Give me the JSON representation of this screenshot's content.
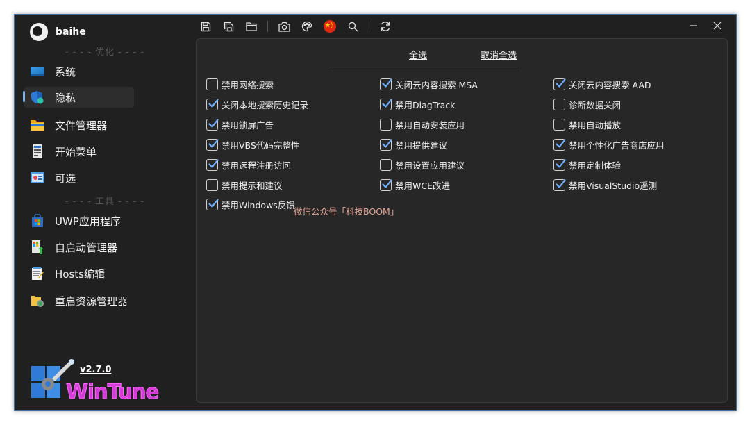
{
  "user": {
    "name": "baihe"
  },
  "sidebar": {
    "section_optimize": "- - - - 优化 - - - -",
    "section_tools": "- - - - 工具 - - - -",
    "items": [
      {
        "label": "系统",
        "icon": "monitor-icon"
      },
      {
        "label": "隐私",
        "icon": "shield-icon",
        "active": true
      },
      {
        "label": "文件管理器",
        "icon": "folder-icon"
      },
      {
        "label": "开始菜单",
        "icon": "start-menu-icon"
      },
      {
        "label": "可选",
        "icon": "options-icon"
      },
      {
        "label": "UWP应用程序",
        "icon": "windows-store-icon"
      },
      {
        "label": "自启动管理器",
        "icon": "startup-icon"
      },
      {
        "label": "Hosts编辑",
        "icon": "notepad-icon"
      },
      {
        "label": "重启资源管理器",
        "icon": "restart-explorer-icon"
      }
    ],
    "version": "v2.7.0",
    "logo_text": "WinTune"
  },
  "toolbar": {
    "buttons": [
      "save-icon",
      "save-all-icon",
      "open-folder-icon",
      "camera-icon",
      "palette-icon",
      "china-flag-icon",
      "search-icon",
      "refresh-icon"
    ]
  },
  "panel": {
    "select_all": "全选",
    "deselect_all": "取消全选",
    "options": [
      {
        "label": "禁用网络搜索",
        "checked": false
      },
      {
        "label": "关闭云内容搜索 MSA",
        "checked": true
      },
      {
        "label": "关闭云内容搜索 AAD",
        "checked": true
      },
      {
        "label": "关闭本地搜索历史记录",
        "checked": true
      },
      {
        "label": "禁用DiagTrack",
        "checked": true
      },
      {
        "label": "诊断数据关闭",
        "checked": false
      },
      {
        "label": "禁用锁屏广告",
        "checked": true
      },
      {
        "label": "禁用自动安装应用",
        "checked": false
      },
      {
        "label": "禁用自动播放",
        "checked": false
      },
      {
        "label": "禁用VBS代码完整性",
        "checked": true
      },
      {
        "label": "禁用提供建议",
        "checked": true
      },
      {
        "label": "禁用个性化广告商店应用",
        "checked": true
      },
      {
        "label": "禁用远程注册访问",
        "checked": true
      },
      {
        "label": "禁用设置应用建议",
        "checked": false
      },
      {
        "label": "禁用定制体验",
        "checked": true
      },
      {
        "label": "禁用提示和建议",
        "checked": false
      },
      {
        "label": "禁用WCE改进",
        "checked": true
      },
      {
        "label": "禁用VisualStudio遥测",
        "checked": true
      },
      {
        "label": "禁用Windows反馈",
        "checked": true
      }
    ],
    "watermark": "微信公众号「科技BOOM」"
  },
  "colors": {
    "accent": "#7fb2e5",
    "background": "#202020",
    "panel": "#272727"
  }
}
